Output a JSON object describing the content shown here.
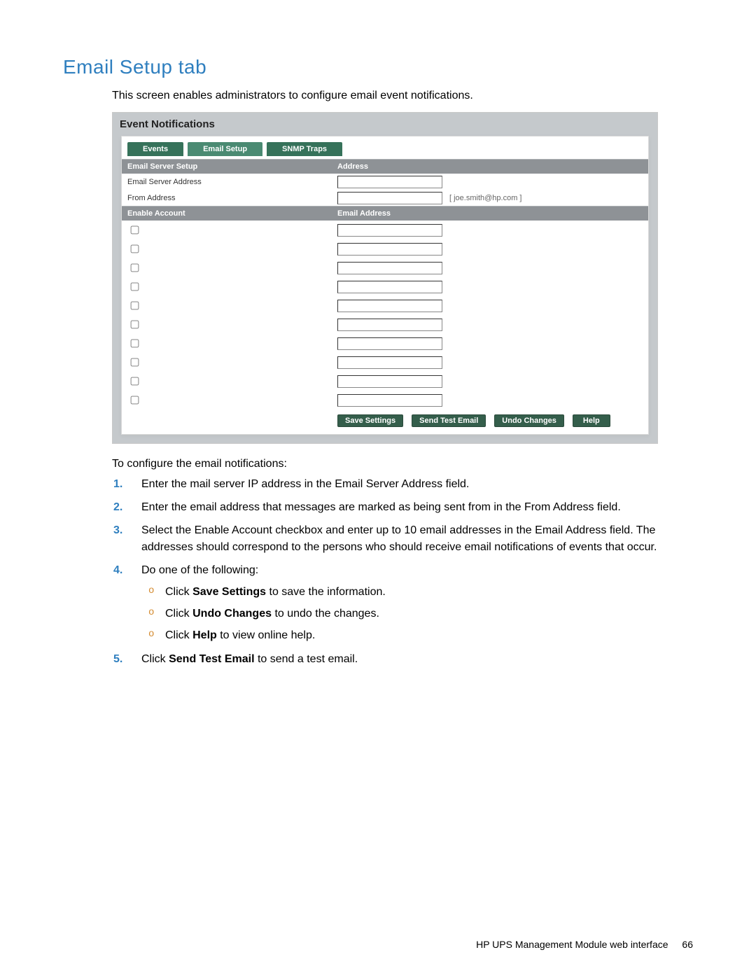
{
  "title": "Email Setup tab",
  "intro": "This screen enables administrators to configure email event notifications.",
  "panel": {
    "header": "Event Notifications",
    "tabs": [
      "Events",
      "Email Setup",
      "SNMP Traps"
    ],
    "active_tab_index": 1,
    "server_section": {
      "col1": "Email Server Setup",
      "col2": "Address",
      "rows": [
        {
          "label": "Email Server Address",
          "value": "",
          "hint": ""
        },
        {
          "label": "From Address",
          "value": "",
          "hint": "[ joe.smith@hp.com ]"
        }
      ]
    },
    "accounts_section": {
      "col1": "Enable Account",
      "col2": "Email Address",
      "rows": 10
    },
    "buttons": [
      "Save Settings",
      "Send Test Email",
      "Undo Changes",
      "Help"
    ]
  },
  "instructions_intro": "To configure the email notifications:",
  "steps": [
    {
      "text": "Enter the mail server IP address in the Email Server Address field."
    },
    {
      "text": "Enter the email address that messages are marked as being sent from in the From Address field."
    },
    {
      "text": "Select the Enable Account checkbox and enter up to 10 email addresses in the Email Address field. The addresses should correspond to the persons who should receive email notifications of events that occur."
    },
    {
      "text": "Do one of the following:",
      "sub": [
        {
          "prefix": "Click ",
          "bold": "Save Settings",
          "suffix": " to save the information."
        },
        {
          "prefix": "Click ",
          "bold": "Undo Changes",
          "suffix": " to undo the changes."
        },
        {
          "prefix": "Click ",
          "bold": "Help",
          "suffix": " to view online help."
        }
      ]
    },
    {
      "prefix": "Click ",
      "bold": "Send Test Email",
      "suffix": " to send a test email."
    }
  ],
  "footer": {
    "text": "HP UPS Management Module web interface",
    "page": "66"
  }
}
